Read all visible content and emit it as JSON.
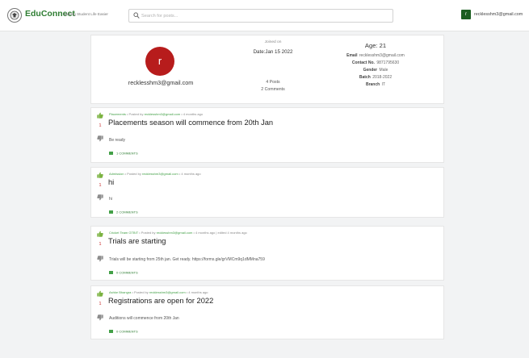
{
  "header": {
    "brand": "EduConnect",
    "tagline": "Making Student Life Easier",
    "search_placeholder": "Search for posts...",
    "user_initial": "r",
    "user_email": "recklesshm3@gmail.com"
  },
  "profile": {
    "avatar_letter": "r",
    "email": "recklesshm3@gmail.com",
    "joined_label": "Joined on",
    "joined_date": "Date:Jan 15 2022",
    "posts": "4 Posts",
    "comments": "2 Comments",
    "age": "Age: 21",
    "details": [
      {
        "label": "Email",
        "value": "recklesshm3@gmail.com"
      },
      {
        "label": "Contact No.",
        "value": "9871795630"
      },
      {
        "label": "Gender",
        "value": "Male"
      },
      {
        "label": "Batch",
        "value": "2018-2022"
      },
      {
        "label": "Branch",
        "value": "IT"
      }
    ]
  },
  "posts": [
    {
      "votes": "1",
      "group": "Placements",
      "posted_by_label": "Posted by",
      "author": "recklesshm3@gmail.com",
      "time": "4 months ago",
      "edited": "",
      "title": "Placements season will commence from 20th Jan",
      "body": "Be ready",
      "comments_label": "1 COMMENTS"
    },
    {
      "votes": "1",
      "group": "Admission",
      "posted_by_label": "Posted by",
      "author": "recklesshm3@gmail.com",
      "time": "4 months ago",
      "edited": "",
      "title": "hi",
      "body": "hi",
      "comments_label": "2 COMMENTS"
    },
    {
      "votes": "1",
      "group": "Cricket Team GTBIT",
      "posted_by_label": "Posted by",
      "author": "recklesshm3@gmail.com",
      "time": "4 months ago",
      "edited": "edited 4 months ago",
      "title": "Trials are starting",
      "body": "Trials will be starting from 25th jan. Get ready. https://forms.gle/grVMCm9q1dMMna759",
      "comments_label": "0 COMMENTS"
    },
    {
      "votes": "1",
      "group": "Ashke Bhangra",
      "posted_by_label": "Posted by",
      "author": "recklesshm3@gmail.com",
      "time": "4 months ago",
      "edited": "",
      "title": "Registrations are open for 2022",
      "body": "Auditions will commence from 20th Jan",
      "comments_label": "0 COMMENTS"
    }
  ],
  "colors": {
    "brand_green": "#2e7d32",
    "avatar_red": "#b71c1c",
    "vote_red": "#c62828",
    "link_green": "#43a047"
  }
}
